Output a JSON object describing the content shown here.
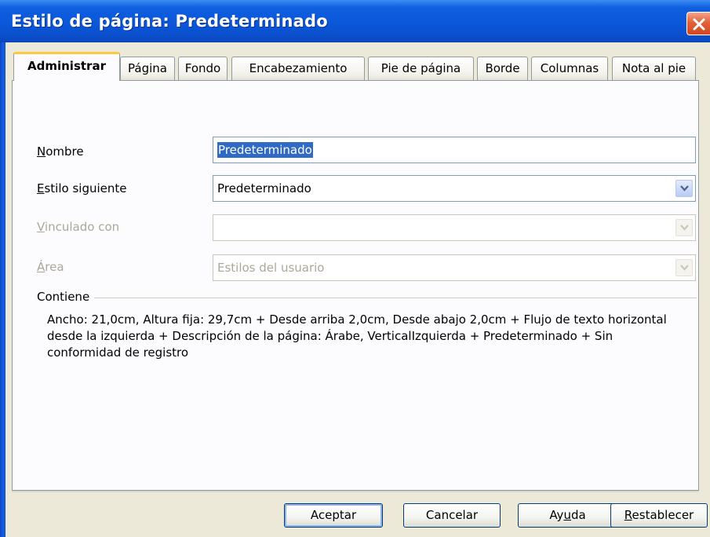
{
  "window": {
    "title": "Estilo de página: Predeterminado"
  },
  "tabs": [
    {
      "label": "Administrar",
      "active": true
    },
    {
      "label": "Página",
      "active": false
    },
    {
      "label": "Fondo",
      "active": false
    },
    {
      "label": "Encabezamiento",
      "active": false
    },
    {
      "label": "Pie de página",
      "active": false
    },
    {
      "label": "Borde",
      "active": false
    },
    {
      "label": "Columnas",
      "active": false
    },
    {
      "label": "Nota al pie",
      "active": false
    }
  ],
  "form": {
    "name_label_mnemonic": "N",
    "name_label_rest": "ombre",
    "name_value": "Predeterminado",
    "next_style_label_mnemonic": "E",
    "next_style_label_rest": "stilo siguiente",
    "next_style_value": "Predeterminado",
    "linked_label_mnemonic": "V",
    "linked_label_rest": "inculado con",
    "linked_value": "",
    "area_label_mnemonic": "Á",
    "area_label_rest": "rea",
    "area_value": "Estilos del usuario"
  },
  "contains": {
    "label": "Contiene",
    "text": "Ancho: 21,0cm, Altura fija: 29,7cm + Desde arriba 2,0cm, Desde abajo 2,0cm + Flujo de texto horizontal desde la izquierda + Descripción de la página:  Árabe, VerticalIzquierda + Predeterminado + Sin conformidad de registro"
  },
  "buttons": {
    "accept": "Aceptar",
    "cancel": "Cancelar",
    "help_pre": "Ay",
    "help_mnemonic": "u",
    "help_post": "da",
    "reset_mnemonic": "R",
    "reset_rest": "establecer"
  },
  "colors": {
    "titlebar": "#0a56d8",
    "active_tab_accent": "#ffc73c",
    "selection": "#316ac5",
    "dialog_bg": "#ece9d8"
  }
}
